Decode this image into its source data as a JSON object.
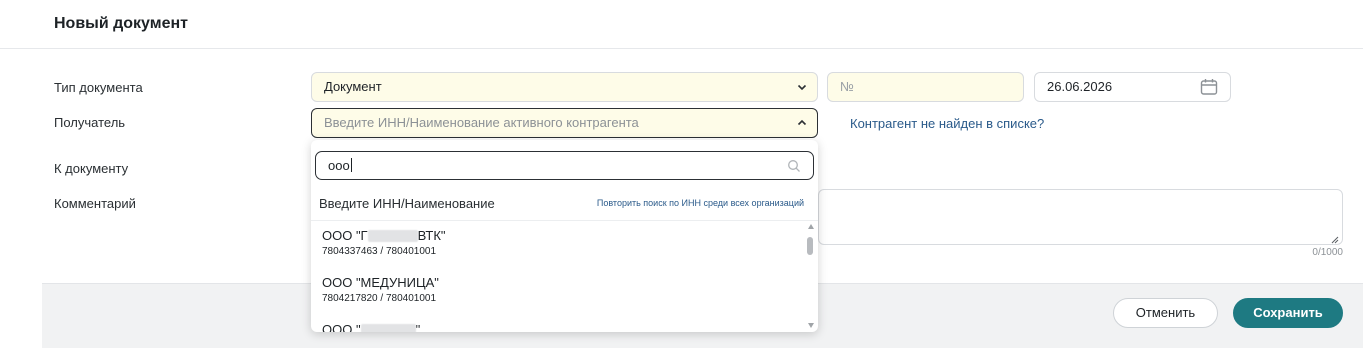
{
  "header": {
    "title": "Новый документ"
  },
  "form": {
    "doc_type_label": "Тип документа",
    "doc_type_value": "Документ",
    "number_placeholder": "№",
    "date_value": "26.06.2026",
    "recipient_label": "Получатель",
    "recipient_placeholder": "Введите ИНН/Наименование активного контрагента",
    "not_found_link": "Контрагент не найден в списке?",
    "to_document_label": "К документу",
    "comment_label": "Комментарий",
    "comment_counter": "0/1000"
  },
  "dropdown": {
    "search_value": "ооо",
    "hint": "Введите ИНН/Наименование",
    "retry_link": "Повторить поиск по ИНН среди всех организаций",
    "items": [
      {
        "name_prefix": "ООО \"Г",
        "name_suffix": "ВТК\"",
        "inn": "7804337463 / 780401001"
      },
      {
        "name_prefix": "ООО \"МЕДУНИЦА\"",
        "name_suffix": "",
        "inn": "7804217820 / 780401001"
      },
      {
        "name_prefix": "ООО \"",
        "name_suffix": "\"",
        "inn": ""
      }
    ]
  },
  "footer": {
    "cancel": "Отменить",
    "save": "Сохранить"
  },
  "colors": {
    "accent": "#1e7a82",
    "field_bg": "#fefce8",
    "link": "#2a5a8a"
  }
}
